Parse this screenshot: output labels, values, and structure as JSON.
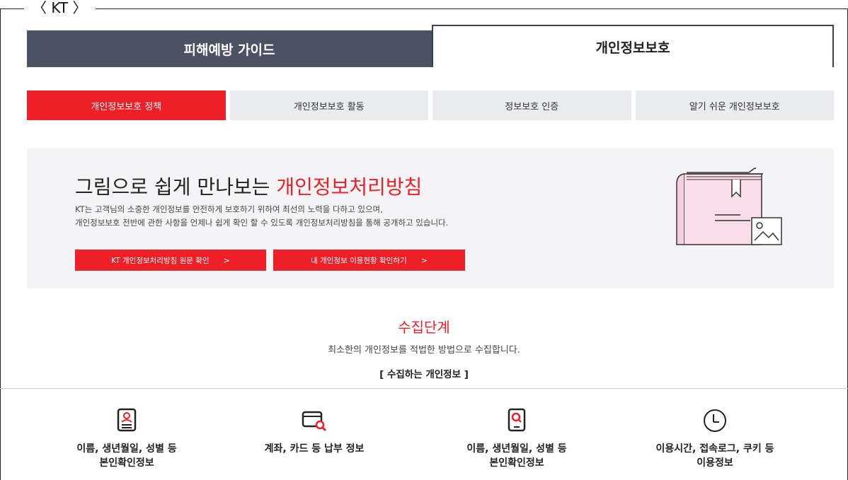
{
  "frame": {
    "label": "〈 KT 〉"
  },
  "main_tabs": [
    {
      "label": "피해예방 가이드",
      "active": false
    },
    {
      "label": "개인정보보호",
      "active": true
    }
  ],
  "sub_tabs": [
    {
      "label": "개인정보보호 정책",
      "active": true
    },
    {
      "label": "개인정보보호 활동",
      "active": false
    },
    {
      "label": "정보보호 인증",
      "active": false
    },
    {
      "label": "알기 쉬운 개인정보보호",
      "active": false
    }
  ],
  "hero": {
    "title_prefix": "그림으로 쉽게 만나보는 ",
    "title_accent": "개인정보처리방침",
    "desc_line1": "KT는 고객님의 소중한 개인정보를 안전하게 보호하기 위하여 최선의 노력을 다하고 있으며,",
    "desc_line2": "개인정보보호 전반에 관한 사항을 언제나 쉽게 확인 할 수 있도록 개인정보처리방침을 통해 공개하고 있습니다.",
    "button1": "KT 개인정보처리방침 원문 확인",
    "button2": "내 개인정보 이용현황 확인하기",
    "chevron": ">"
  },
  "section": {
    "title": "수집단계",
    "subtitle": "최소한의 개인정보를 적법한 방법으로 수집합니다.",
    "heading": "[ 수집하는 개인정보 ]"
  },
  "info_items": [
    {
      "icon": "id-card-icon",
      "line1": "이름, 생년월일, 성별 등",
      "line2": "본인확인정보"
    },
    {
      "icon": "card-search-icon",
      "line1": "계좌, 카드 등 납부 정보",
      "line2": ""
    },
    {
      "icon": "phone-search-icon",
      "line1": "이름, 생년월일, 성별 등",
      "line2": "본인확인정보"
    },
    {
      "icon": "clock-icon",
      "line1": "이용시간, 접속로그, 쿠키 등",
      "line2": "이용정보"
    }
  ],
  "colors": {
    "accent": "#ef1f27",
    "tab_dark": "#4a5264",
    "subtab_bg": "#e9ebee",
    "hero_bg": "#f4f4f6"
  }
}
